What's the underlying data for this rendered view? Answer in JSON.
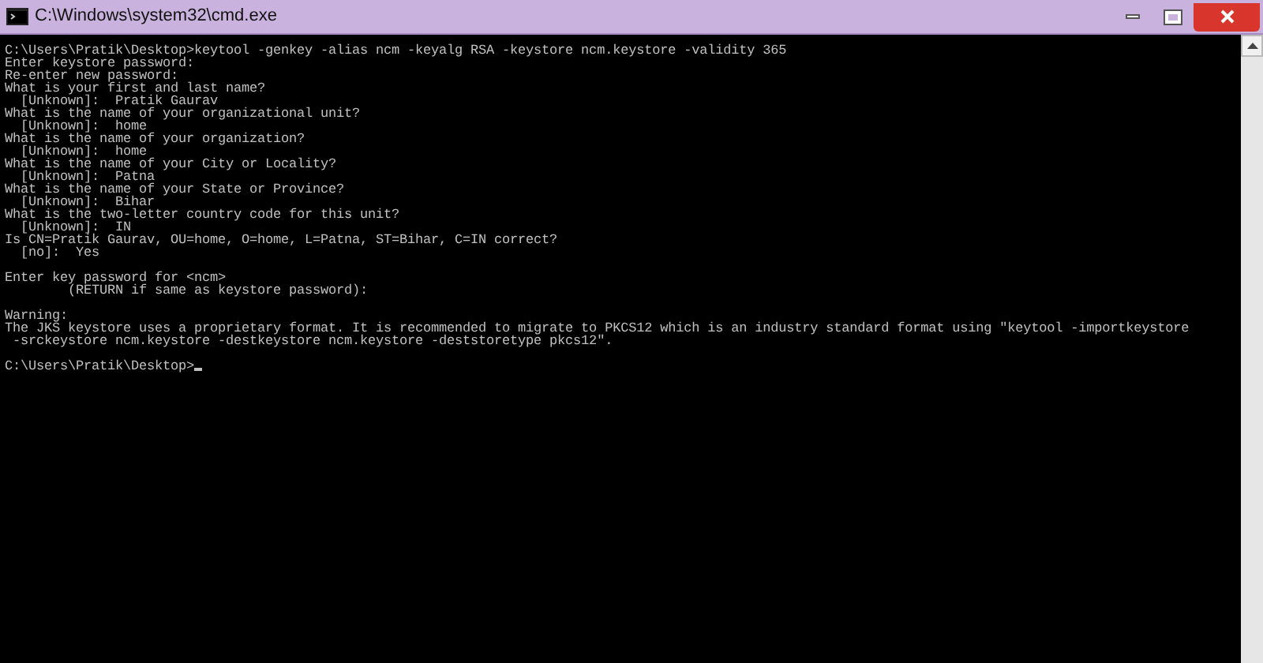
{
  "window": {
    "title": "C:\\Windows\\system32\\cmd.exe"
  },
  "console": {
    "blocks": [
      [
        "C:\\Users\\Pratik\\Desktop>keytool -genkey -alias ncm -keyalg RSA -keystore ncm.keystore -validity 365",
        "Enter keystore password:",
        "Re-enter new password:",
        "What is your first and last name?",
        "  [Unknown]:  Pratik Gaurav",
        "What is the name of your organizational unit?",
        "  [Unknown]:  home",
        "What is the name of your organization?",
        "  [Unknown]:  home",
        "What is the name of your City or Locality?",
        "  [Unknown]:  Patna",
        "What is the name of your State or Province?",
        "  [Unknown]:  Bihar",
        "What is the two-letter country code for this unit?",
        "  [Unknown]:  IN",
        "Is CN=Pratik Gaurav, OU=home, O=home, L=Patna, ST=Bihar, C=IN correct?",
        "  [no]:  Yes"
      ],
      [
        "Enter key password for <ncm>",
        "        (RETURN if same as keystore password):"
      ],
      [
        "Warning:",
        "The JKS keystore uses a proprietary format. It is recommended to migrate to PKCS12 which is an industry standard format using \"keytool -importkeystore",
        " -srckeystore ncm.keystore -destkeystore ncm.keystore -deststoretype pkcs12\"."
      ]
    ],
    "prompt": "C:\\Users\\Pratik\\Desktop>",
    "cursor": true
  }
}
